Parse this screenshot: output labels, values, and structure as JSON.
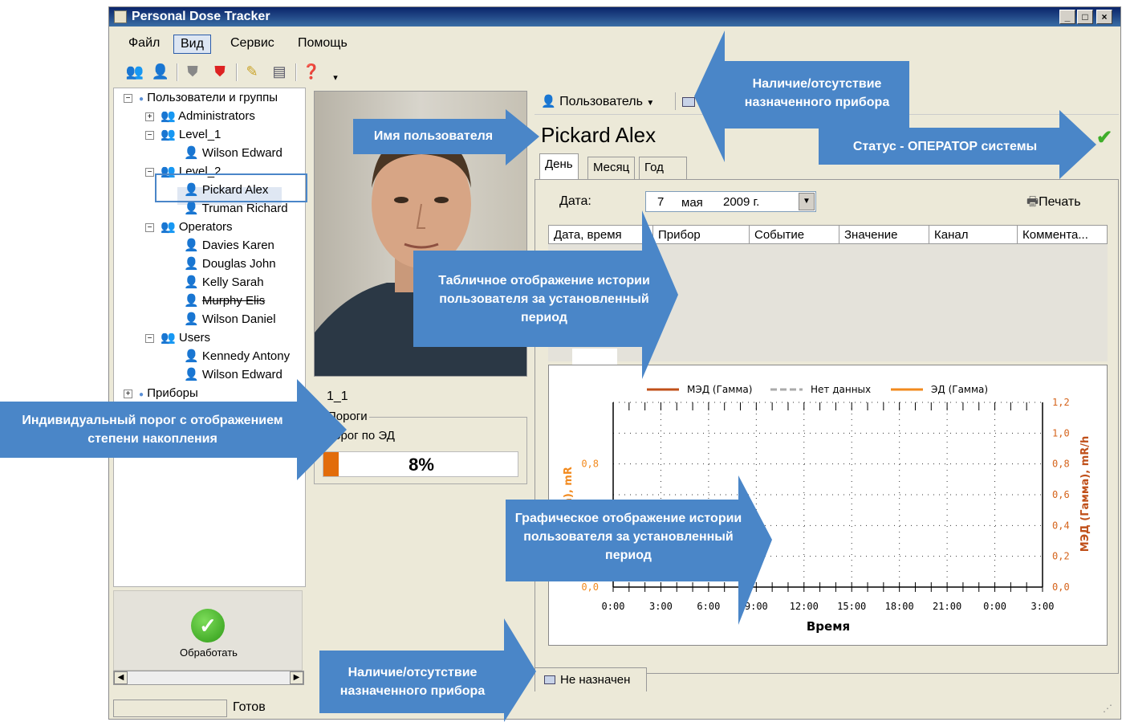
{
  "app": {
    "title": "Personal Dose Tracker",
    "min_btn": "_",
    "max_btn": "□",
    "close_btn": "×"
  },
  "menu": [
    "Файл",
    "Вид",
    "Сервис",
    "Помощь"
  ],
  "toolbar_icons": [
    "users-icon",
    "add-user-icon",
    "shield-icon",
    "shield-remove-icon",
    "edit-icon",
    "device-icon",
    "help-icon"
  ],
  "tree": {
    "root_users": "Пользователи и группы",
    "groups": [
      {
        "name": "Administrators",
        "expand": "+",
        "users": []
      },
      {
        "name": "Level_1",
        "expand": "−",
        "users": [
          {
            "name": "Wilson Edward"
          }
        ]
      },
      {
        "name": "Level_2",
        "expand": "−",
        "users": [
          {
            "name": "Pickard Alex",
            "selected": true
          },
          {
            "name": "Truman Richard"
          }
        ]
      },
      {
        "name": "Operators",
        "expand": "−",
        "users": [
          {
            "name": "Davies Karen"
          },
          {
            "name": "Douglas John"
          },
          {
            "name": "Kelly Sarah"
          },
          {
            "name": "Murphy Elis",
            "strike": true
          },
          {
            "name": "Wilson Daniel"
          }
        ]
      },
      {
        "name": "Users",
        "expand": "−",
        "users": [
          {
            "name": "Kennedy Antony"
          },
          {
            "name": "Wilson Edward"
          }
        ]
      }
    ],
    "root_devices": "Приборы",
    "root_devices_expand": "+"
  },
  "process_button": "Обработать",
  "status": "Готов",
  "user_panel": {
    "user_dropdown": "Пользователь",
    "name": "Pickard Alex",
    "id": "1_1",
    "thresholds_group": "Пороги",
    "threshold_label": "порог по ЭД",
    "threshold_value": "8%",
    "threshold_fraction": 0.08,
    "status_color": "#3fae2a"
  },
  "tabs": [
    "День",
    "Месяц",
    "Год"
  ],
  "date": {
    "label": "Дата:",
    "day": "7",
    "month": "мая",
    "year": "2009 г."
  },
  "print_label": "Печать",
  "grid_columns": [
    "Дата, время",
    "Прибор",
    "Событие",
    "Значение",
    "Канал",
    "Коммента..."
  ],
  "device_status": "Не назначен",
  "chart_data": {
    "type": "line",
    "legend": [
      "МЭД (Гамма)",
      "Нет данных",
      "ЭД (Гамма)"
    ],
    "legend_colors": [
      "#c0501a",
      "#aaaaaa",
      "#f28a1e"
    ],
    "x_ticks": [
      "0:00",
      "3:00",
      "6:00",
      "9:00",
      "12:00",
      "15:00",
      "18:00",
      "21:00",
      "0:00",
      "3:00"
    ],
    "xlabel": "Время",
    "ylabel_left": "а), mR",
    "ylabel_right": "МЭД (Гамма), mR/h",
    "y_left_ticks": [
      "0,8",
      "0,0"
    ],
    "y_right_ticks": [
      "1,2",
      "1,0",
      "0,8",
      "0,6",
      "0,4",
      "0,2",
      "0,0"
    ],
    "ylim": [
      0,
      1.2
    ],
    "series": [],
    "grid": true,
    "legend_placement": "top"
  },
  "callouts": {
    "presence_top": "Наличие/отсутствие назначенного прибора",
    "user_name": "Имя пользователя",
    "operator_status": "Статус - ОПЕРАТОР системы",
    "table_history": "Табличное отображение истории пользователя за установленный период",
    "threshold": "Индивидуальный порог с отображением степени накопления",
    "graph_history": "Графическое отображение истории пользователя за установленный период",
    "presence_bottom": "Наличие/отсутствие назначенного прибора"
  },
  "callout_color": "#4a86c8"
}
